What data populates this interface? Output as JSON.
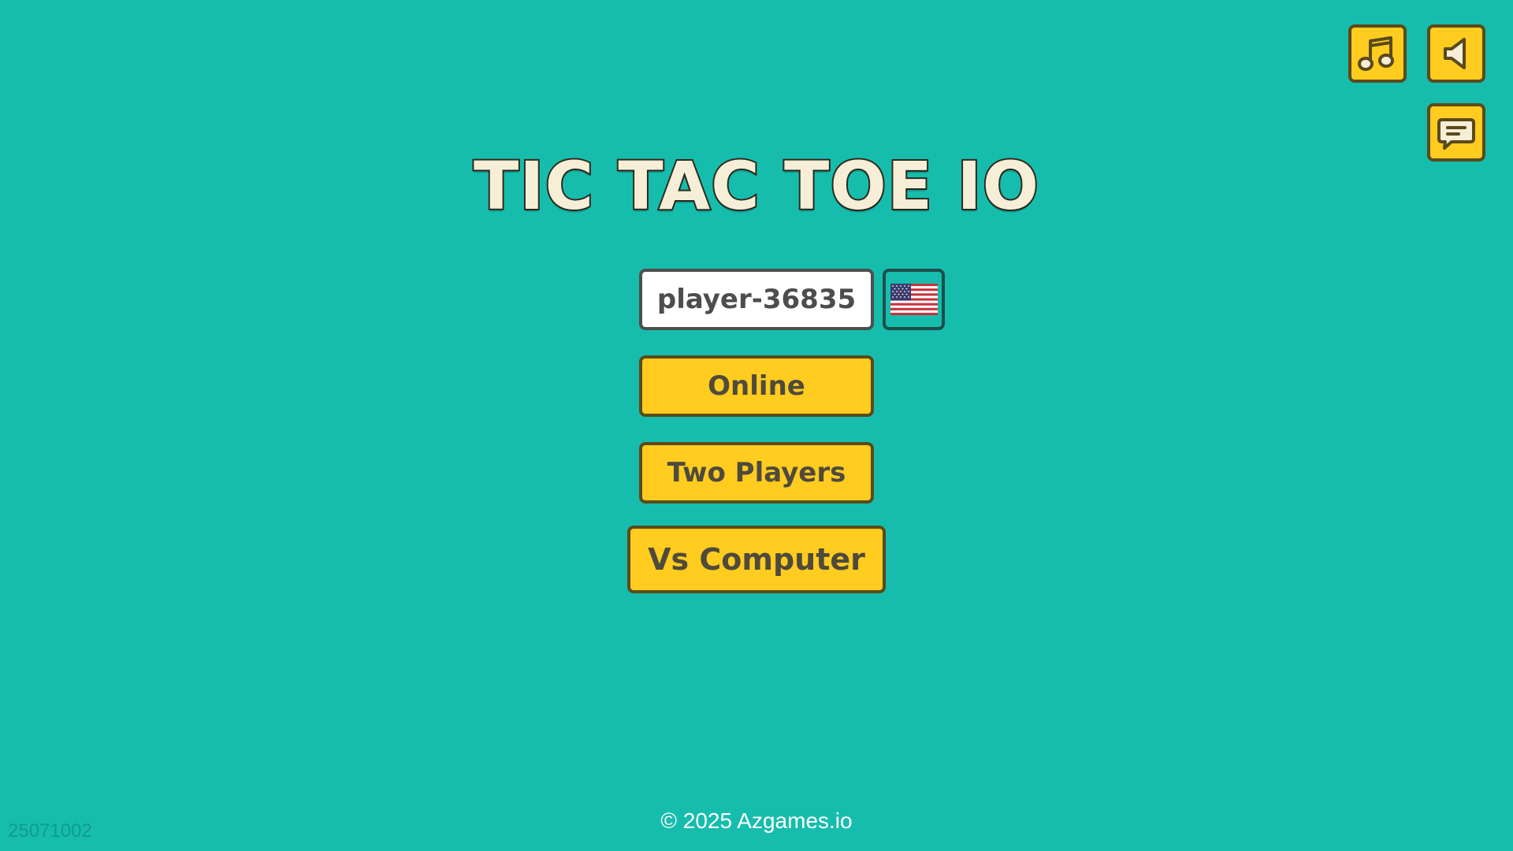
{
  "title": "TIC TAC TOE IO",
  "player": {
    "name": "player-36835",
    "flag_icon": "us-flag-icon"
  },
  "menu": {
    "online_label": "Online",
    "two_players_label": "Two Players",
    "vs_computer_label": "Vs Computer"
  },
  "corner_controls": {
    "music_icon": "music-note-icon",
    "sound_icon": "speaker-icon",
    "chat_icon": "chat-bubble-icon"
  },
  "footer": {
    "copyright": "© 2025 Azgames.io",
    "version": "25071002"
  },
  "colors": {
    "background": "#16bdad",
    "button_fill": "#ffcc1f",
    "button_border": "#5a4a1c",
    "button_text": "#4f4a3c",
    "title_fill": "#f6eed6",
    "title_stroke": "#2f2a1e"
  }
}
